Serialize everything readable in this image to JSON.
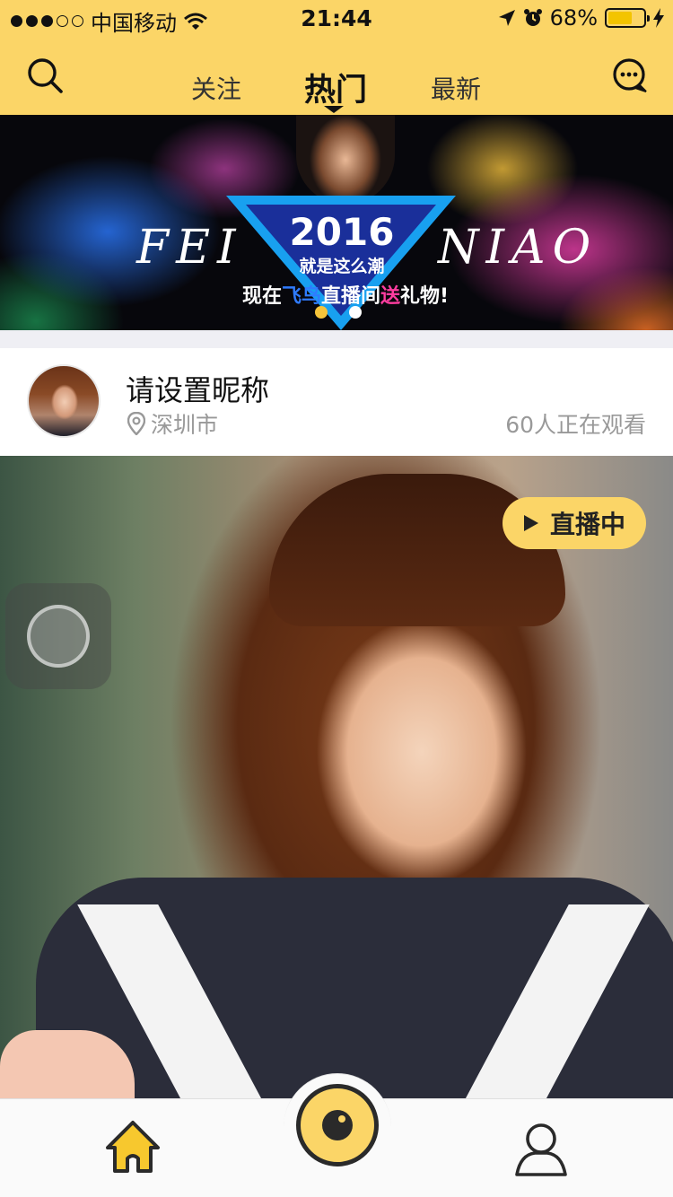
{
  "status_bar": {
    "carrier": "中国移动",
    "time": "21:44",
    "battery": "68%",
    "battery_level": 0.68,
    "signal_bars_filled": 3,
    "signal_bars_total": 5
  },
  "nav": {
    "tabs": [
      {
        "label": "关注"
      },
      {
        "label": "热门"
      },
      {
        "label": "最新"
      }
    ],
    "active_tab": "热门",
    "left_icon": "search-icon",
    "right_icon": "chat-icon"
  },
  "banner": {
    "left_word": "FEI",
    "right_word": "NIAO",
    "year": "2016",
    "tagline": "就是这么潮",
    "promo_prefix": "现在",
    "promo_brand": "飞鸟",
    "promo_mid": "直播间",
    "promo_gift": "送",
    "promo_suffix": "礼物!",
    "pages": 2,
    "active_page": 1
  },
  "feed": {
    "nickname": "请设置昵称",
    "location": "深圳市",
    "viewers": "60人正在观看",
    "live_badge": "直播中"
  },
  "tabbar": {
    "items": [
      "home-icon",
      "live-camera-icon",
      "profile-icon"
    ]
  },
  "colors": {
    "accent": "#fbd567",
    "muted_text": "#999999",
    "divider": "#efeff4"
  }
}
